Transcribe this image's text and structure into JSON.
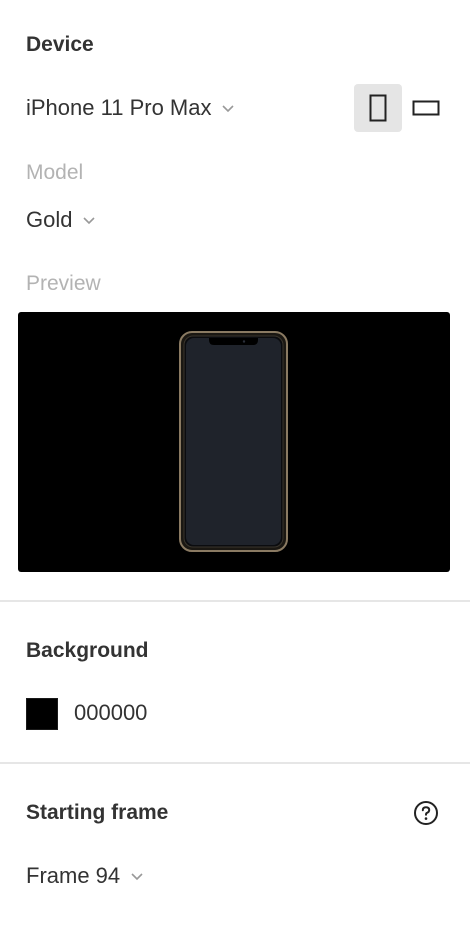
{
  "device": {
    "title": "Device",
    "selected": "iPhone 11 Pro Max",
    "orientation": "portrait"
  },
  "model": {
    "label": "Model",
    "selected": "Gold"
  },
  "preview": {
    "label": "Preview"
  },
  "background": {
    "title": "Background",
    "hex": "000000",
    "color": "#000000"
  },
  "starting_frame": {
    "title": "Starting frame",
    "selected": "Frame 94"
  },
  "icons": {
    "orientation_portrait": "portrait-phone-icon",
    "orientation_landscape": "landscape-phone-icon",
    "dropdown": "chevron-down-icon",
    "help": "question-circle-icon"
  },
  "colors": {
    "device_frame": "#8a7a62",
    "device_screen": "#1f232b",
    "preview_bg": "#000000"
  }
}
